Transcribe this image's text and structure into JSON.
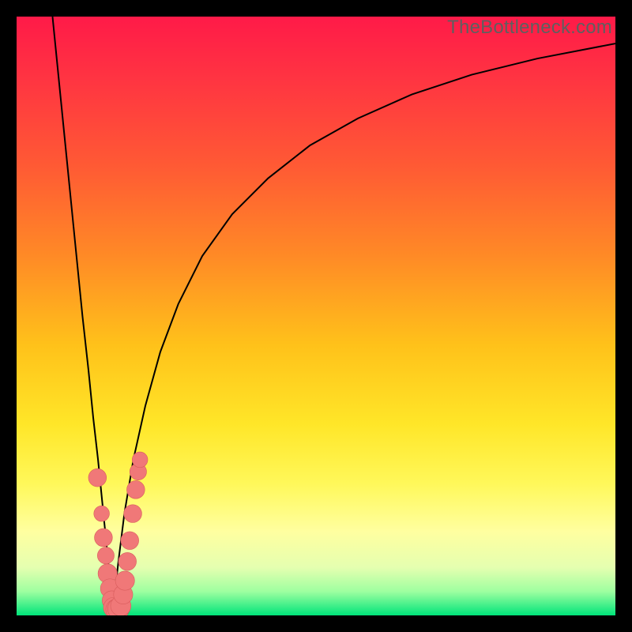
{
  "watermark": "TheBottleneck.com",
  "colors": {
    "curve": "#000000",
    "marker_fill": "#f07878",
    "marker_stroke": "#d85c5c",
    "gradient_stops": [
      {
        "offset": 0.0,
        "color": "#ff1a48"
      },
      {
        "offset": 0.1,
        "color": "#ff3342"
      },
      {
        "offset": 0.25,
        "color": "#ff5a34"
      },
      {
        "offset": 0.4,
        "color": "#ff8a26"
      },
      {
        "offset": 0.55,
        "color": "#ffc21a"
      },
      {
        "offset": 0.68,
        "color": "#ffe628"
      },
      {
        "offset": 0.78,
        "color": "#fff85a"
      },
      {
        "offset": 0.86,
        "color": "#ffffa0"
      },
      {
        "offset": 0.92,
        "color": "#e5ffb0"
      },
      {
        "offset": 0.96,
        "color": "#9effa0"
      },
      {
        "offset": 1.0,
        "color": "#00e47a"
      }
    ]
  },
  "chart_data": {
    "type": "line",
    "title": "",
    "xlabel": "",
    "ylabel": "",
    "xlim": [
      0,
      100
    ],
    "ylim": [
      0,
      100
    ],
    "x_sweet_spot": 16,
    "series": [
      {
        "name": "left-curve",
        "x": [
          6.0,
          7.0,
          8.0,
          9.0,
          10.0,
          11.0,
          12.0,
          12.8,
          13.6,
          14.3,
          14.9,
          15.4,
          15.8,
          16.0
        ],
        "y": [
          100,
          90,
          80,
          70,
          60,
          50,
          41,
          33,
          26,
          19,
          13,
          8,
          3,
          0
        ]
      },
      {
        "name": "right-curve",
        "x": [
          16.0,
          17.0,
          18.0,
          19.5,
          21.5,
          24.0,
          27.0,
          31.0,
          36.0,
          42.0,
          49.0,
          57.0,
          66.0,
          76.0,
          87.0,
          100.0
        ],
        "y": [
          0,
          9,
          17,
          26,
          35,
          44,
          52,
          60,
          67,
          73,
          78.5,
          83,
          87,
          90.3,
          93,
          95.5
        ]
      }
    ],
    "markers": [
      {
        "x": 13.5,
        "y": 23,
        "r": 1.5
      },
      {
        "x": 14.2,
        "y": 17,
        "r": 1.3
      },
      {
        "x": 14.5,
        "y": 13,
        "r": 1.5
      },
      {
        "x": 14.9,
        "y": 10,
        "r": 1.4
      },
      {
        "x": 15.2,
        "y": 7,
        "r": 1.6
      },
      {
        "x": 15.6,
        "y": 4.5,
        "r": 1.6
      },
      {
        "x": 15.9,
        "y": 2.5,
        "r": 1.6
      },
      {
        "x": 16.2,
        "y": 1.3,
        "r": 1.7
      },
      {
        "x": 16.6,
        "y": 1.0,
        "r": 1.7
      },
      {
        "x": 17.0,
        "y": 1.1,
        "r": 1.8
      },
      {
        "x": 17.4,
        "y": 1.6,
        "r": 1.7
      },
      {
        "x": 17.8,
        "y": 3.5,
        "r": 1.6
      },
      {
        "x": 18.1,
        "y": 5.8,
        "r": 1.6
      },
      {
        "x": 18.5,
        "y": 9.0,
        "r": 1.5
      },
      {
        "x": 18.9,
        "y": 12.5,
        "r": 1.5
      },
      {
        "x": 19.4,
        "y": 17,
        "r": 1.5
      },
      {
        "x": 19.9,
        "y": 21,
        "r": 1.5
      },
      {
        "x": 20.3,
        "y": 24,
        "r": 1.4
      },
      {
        "x": 20.6,
        "y": 26,
        "r": 1.3
      }
    ]
  }
}
